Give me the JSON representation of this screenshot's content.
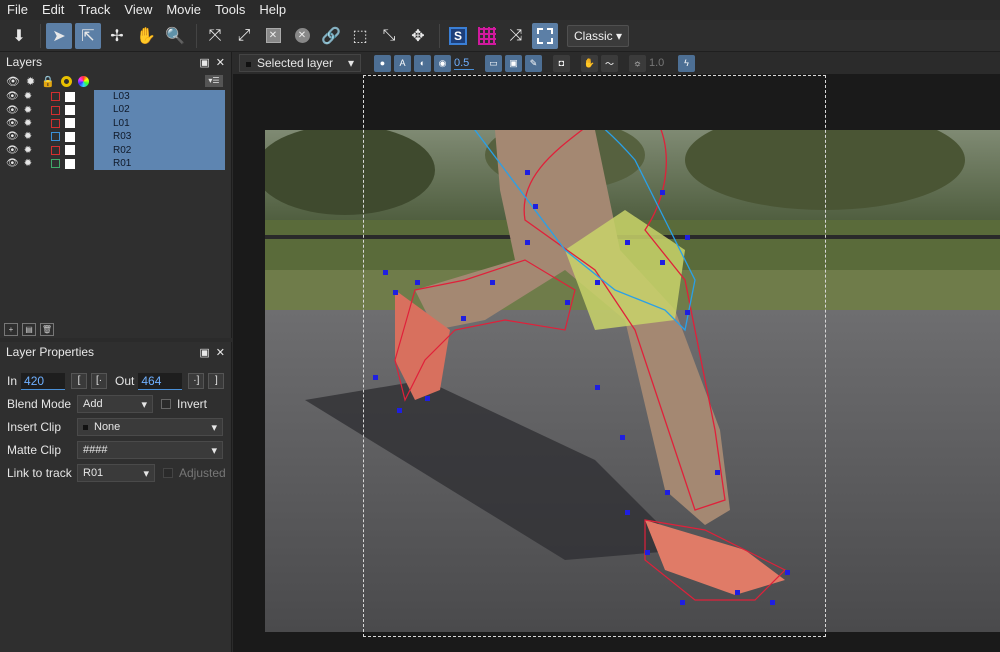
{
  "menu": [
    "File",
    "Edit",
    "Track",
    "View",
    "Movie",
    "Tools",
    "Help"
  ],
  "toolbar": {
    "icons": [
      "download-icon",
      "select-arrow-icon",
      "select-point-icon",
      "add-point-icon",
      "hand-icon",
      "zoom-icon",
      "link-icon",
      "unlink-icon",
      "stabilize-icon",
      "clear-icon",
      "clear-circle-icon",
      "chain-link-icon",
      "dashed-shape-icon",
      "transform-icon",
      "move-icon",
      "surface-s-icon",
      "grid-icon",
      "scale-icon",
      "dashed-rect-icon"
    ],
    "view_mode": "Classic"
  },
  "layers_panel": {
    "title": "Layers",
    "layers": [
      {
        "name": "L03",
        "color": "#d32f2f"
      },
      {
        "name": "L02",
        "color": "#d32f2f"
      },
      {
        "name": "L01",
        "color": "#d32f2f"
      },
      {
        "name": "R03",
        "color": "#3a8fd6"
      },
      {
        "name": "R02",
        "color": "#d32f2f"
      },
      {
        "name": "R01",
        "color": "#3faa6a"
      }
    ]
  },
  "props_panel": {
    "title": "Layer Properties",
    "in_label": "In",
    "in_value": "420",
    "out_label": "Out",
    "out_value": "464",
    "blend_label": "Blend Mode",
    "blend_value": "Add",
    "invert_label": "Invert",
    "insert_label": "Insert Clip",
    "insert_value": "None",
    "matte_label": "Matte Clip",
    "matte_value": "####",
    "link_label": "Link to track",
    "link_value": "R01",
    "adjusted_label": "Adjusted"
  },
  "viewer": {
    "layer_select": "Selected layer",
    "opacity": "0.5",
    "brightness": "1.0"
  },
  "colors": {
    "accent": "#5e85b1",
    "field_text": "#6fb0ff",
    "spline_red": "#e0203a",
    "spline_blue": "#2aa0e8",
    "point_blue": "#1f1fe0"
  }
}
